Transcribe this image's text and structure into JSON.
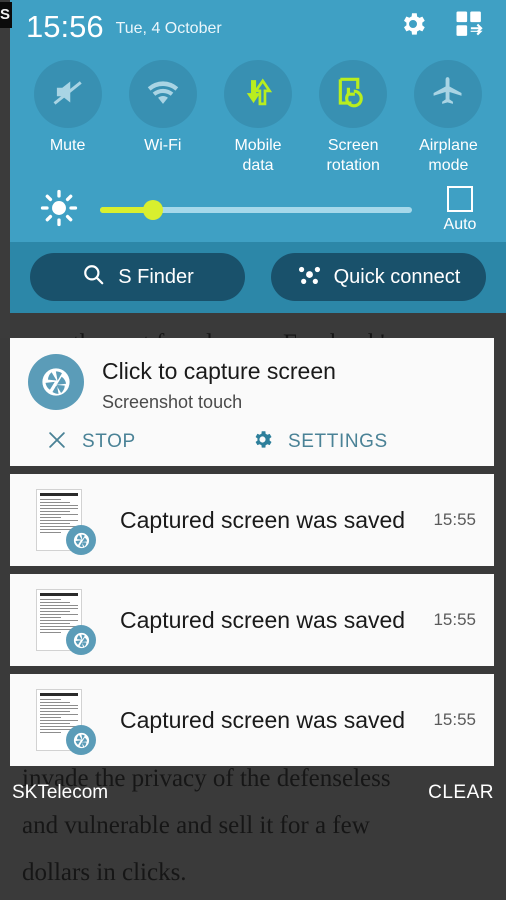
{
  "background": {
    "lines": [
      "over the past few days on Facebook's",
      "invade the privacy of the defenseless",
      "and vulnerable and sell it for a few",
      "dollars in clicks."
    ]
  },
  "status_bar": {
    "ghost_text": "S"
  },
  "quick_settings": {
    "clock": "15:56",
    "date": "Tue, 4 October",
    "settings_icon": "gear-icon",
    "edit_icon": "quick-settings-edit-icon",
    "toggles": [
      {
        "label": "Mute",
        "icon": "mute-icon",
        "active": false
      },
      {
        "label": "Wi-Fi",
        "icon": "wifi-icon",
        "active": false
      },
      {
        "label": "Mobile\ndata",
        "label_line1": "Mobile",
        "label_line2": "data",
        "icon": "mobile-data-icon",
        "active": true
      },
      {
        "label": "Screen\nrotation",
        "label_line1": "Screen",
        "label_line2": "rotation",
        "icon": "screen-rotation-icon",
        "active": true
      },
      {
        "label": "Airplane\nmode",
        "label_line1": "Airplane",
        "label_line2": "mode",
        "icon": "airplane-icon",
        "active": false
      }
    ],
    "brightness": {
      "icon": "brightness-sun-icon",
      "value_percent": 17,
      "auto_label": "Auto",
      "auto_checked": false
    },
    "shortcuts": [
      {
        "label": "S Finder",
        "icon": "search-icon"
      },
      {
        "label": "Quick connect",
        "icon": "quick-connect-hub-icon"
      }
    ]
  },
  "notifications": {
    "ongoing": {
      "icon": "camera-shutter-icon",
      "title": "Click to capture screen",
      "subtitle": "Screenshot touch",
      "actions": [
        {
          "label": "STOP",
          "icon": "close-x-icon"
        },
        {
          "label": "SETTINGS",
          "icon": "gear-icon"
        }
      ]
    },
    "saved": [
      {
        "title": "Captured screen was saved",
        "time": "15:55",
        "icon": "camera-shutter-icon",
        "thumbnail": "screenshot-thumbnail"
      },
      {
        "title": "Captured screen was saved",
        "time": "15:55",
        "icon": "camera-shutter-icon",
        "thumbnail": "screenshot-thumbnail"
      },
      {
        "title": "Captured screen was saved",
        "time": "15:55",
        "icon": "camera-shutter-icon",
        "thumbnail": "screenshot-thumbnail"
      }
    ]
  },
  "bottom_bar": {
    "carrier": "SKTelecom",
    "clear_label": "CLEAR"
  },
  "colors": {
    "panel_blue": "#3fa0c4",
    "panel_blue_dark": "#2c87a8",
    "toggle_circle": "#3890b2",
    "accent_green": "#d9ef2e",
    "pill_dark": "#19516b",
    "action_teal": "#4a8296",
    "shutter_blue": "#5b9cb8"
  }
}
